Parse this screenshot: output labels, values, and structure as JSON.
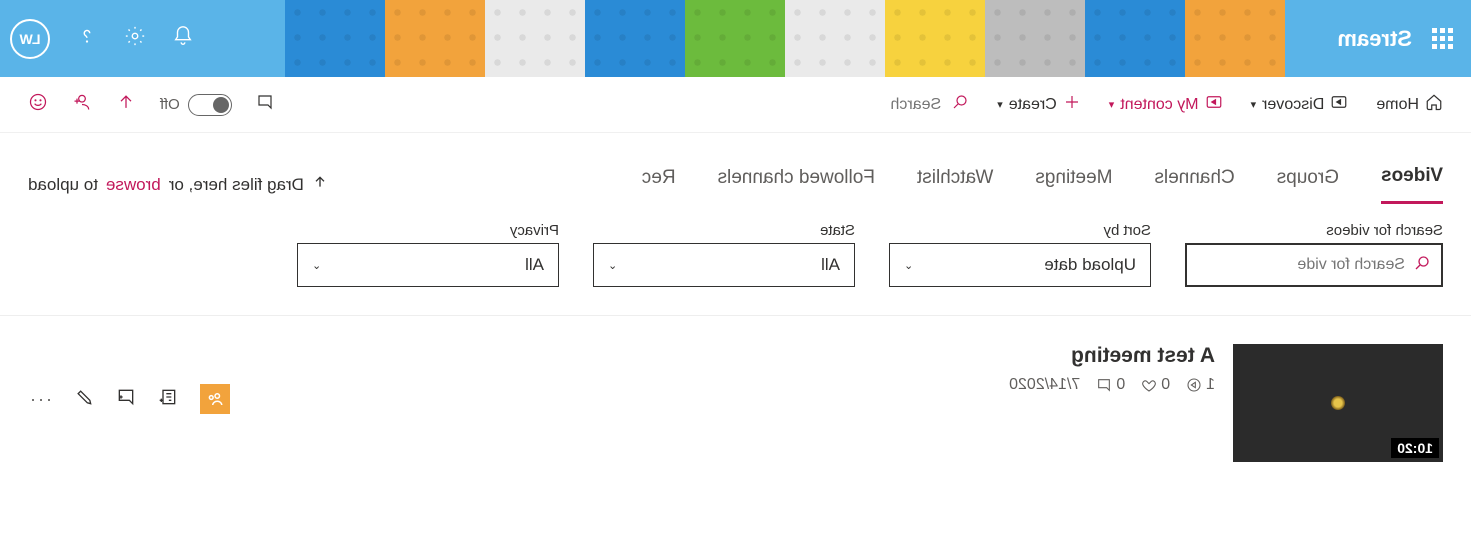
{
  "app": {
    "name": "Stream",
    "avatar": "LW"
  },
  "nav": {
    "home": "Home",
    "discover": "Discover",
    "mycontent": "My content",
    "create": "Create",
    "search_placeholder": "Search",
    "toggle_label": "Off"
  },
  "tabs": {
    "items": [
      {
        "label": "Videos",
        "active": true
      },
      {
        "label": "Groups"
      },
      {
        "label": "Channels"
      },
      {
        "label": "Meetings"
      },
      {
        "label": "Watchlist"
      },
      {
        "label": "Followed channels"
      },
      {
        "label": "Rec"
      }
    ],
    "drag_prefix": "Drag files here, or ",
    "drag_browse": "browse",
    "drag_suffix": " to upload"
  },
  "filters": {
    "search": {
      "label": "Search for videos",
      "placeholder": "Search for vide"
    },
    "sort": {
      "label": "Sort by",
      "value": "Upload date"
    },
    "state": {
      "label": "State",
      "value": "All"
    },
    "privacy": {
      "label": "Privacy",
      "value": "All"
    }
  },
  "video": {
    "title": "A test meeting",
    "views": "1",
    "likes": "0",
    "comments": "0",
    "date": "7/14/2020",
    "duration": "10:20"
  }
}
